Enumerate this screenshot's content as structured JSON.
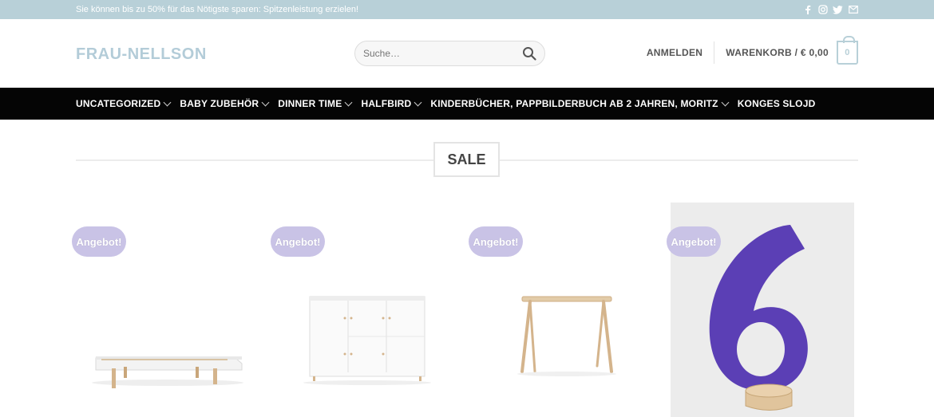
{
  "topbar": {
    "message": "Sie können bis zu 50% für das Nötigste sparen: Spitzenleistung erzielen!",
    "social": [
      "facebook-icon",
      "instagram-icon",
      "twitter-icon",
      "email-icon"
    ]
  },
  "header": {
    "logo": "FRAU-NELLSON",
    "search_placeholder": "Suche…",
    "login": "ANMELDEN",
    "cart": "WARENKORB / € 0,00",
    "cart_count": "0"
  },
  "nav": {
    "items": [
      {
        "label": "UNCATEGORIZED",
        "dropdown": true
      },
      {
        "label": "BABY ZUBEHÖR",
        "dropdown": true
      },
      {
        "label": "DINNER TIME",
        "dropdown": true
      },
      {
        "label": "HALFBIRD",
        "dropdown": true
      },
      {
        "label": "KINDERBÜCHER, PAPPBILDERBUCH AB 2 JAHREN, MORITZ",
        "dropdown": true
      },
      {
        "label": "KONGES SLOJD",
        "dropdown": false
      }
    ]
  },
  "section": {
    "title": "SALE"
  },
  "products": [
    {
      "badge": "Angebot!",
      "image": "white-bed"
    },
    {
      "badge": "Angebot!",
      "image": "white-dresser"
    },
    {
      "badge": "Angebot!",
      "image": "wooden-table"
    },
    {
      "badge": "Angebot!",
      "image": "purple-number-six"
    }
  ],
  "colors": {
    "topbar_bg": "#b8d0d8",
    "nav_bg": "#050505",
    "badge_bg": "#c9c3e6",
    "logo": "#b3ccd8"
  }
}
